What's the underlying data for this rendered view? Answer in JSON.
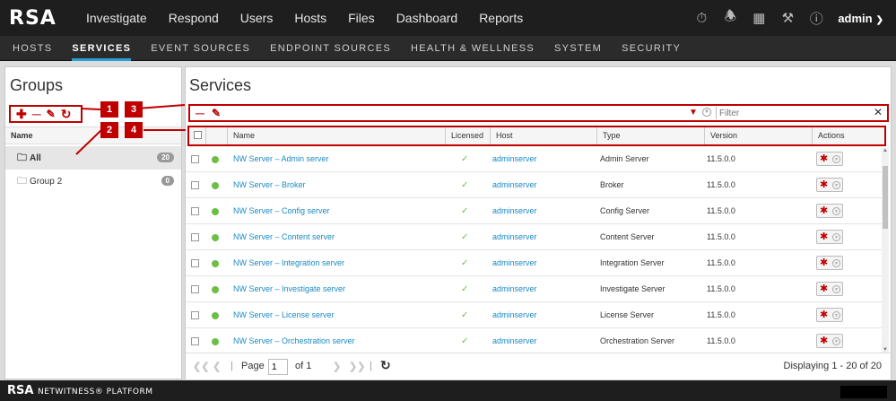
{
  "header": {
    "logo": "RSA",
    "nav": [
      "Investigate",
      "Respond",
      "Users",
      "Hosts",
      "Files",
      "Dashboard",
      "Reports"
    ],
    "user": "admin"
  },
  "subnav": [
    "HOSTS",
    "SERVICES",
    "EVENT SOURCES",
    "ENDPOINT SOURCES",
    "HEALTH & WELLNESS",
    "SYSTEM",
    "SECURITY"
  ],
  "groups": {
    "title": "Groups",
    "column": "Name",
    "items": [
      {
        "label": "All",
        "count": "20"
      },
      {
        "label": "Group 2",
        "count": "0"
      }
    ]
  },
  "services": {
    "title": "Services",
    "filter_placeholder": "Filter",
    "columns": {
      "name": "Name",
      "licensed": "Licensed",
      "host": "Host",
      "type": "Type",
      "version": "Version",
      "actions": "Actions"
    },
    "rows": [
      {
        "name": "NW Server – Admin server",
        "host": "adminserver",
        "type": "Admin Server",
        "version": "11.5.0.0"
      },
      {
        "name": "NW Server – Broker",
        "host": "adminserver",
        "type": "Broker",
        "version": "11.5.0.0"
      },
      {
        "name": "NW Server – Config server",
        "host": "adminserver",
        "type": "Config Server",
        "version": "11.5.0.0"
      },
      {
        "name": "NW Server – Content server",
        "host": "adminserver",
        "type": "Content Server",
        "version": "11.5.0.0"
      },
      {
        "name": "NW Server – Integration server",
        "host": "adminserver",
        "type": "Integration Server",
        "version": "11.5.0.0"
      },
      {
        "name": "NW Server – Investigate server",
        "host": "adminserver",
        "type": "Investigate Server",
        "version": "11.5.0.0"
      },
      {
        "name": "NW Server – License server",
        "host": "adminserver",
        "type": "License Server",
        "version": "11.5.0.0"
      },
      {
        "name": "NW Server – Orchestration server",
        "host": "adminserver",
        "type": "Orchestration Server",
        "version": "11.5.0.0"
      }
    ]
  },
  "pager": {
    "page_label": "Page",
    "page_value": "1",
    "of_label": "of 1",
    "displaying": "Displaying 1 - 20 of 20"
  },
  "callouts": [
    "1",
    "2",
    "3",
    "4"
  ],
  "footer": {
    "brand": "RSA",
    "product": "NETWITNESS® PLATFORM"
  }
}
